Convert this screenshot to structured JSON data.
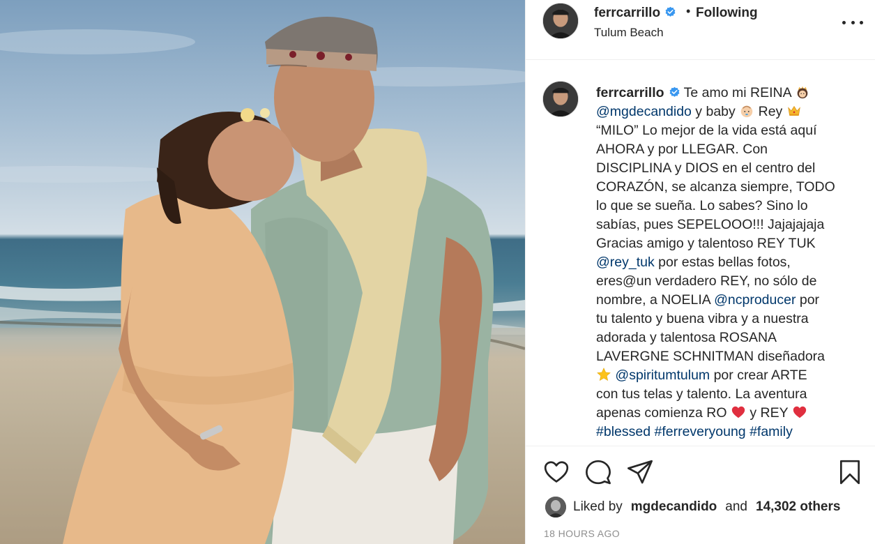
{
  "post": {
    "image_alt": "Couple on beach photo",
    "header": {
      "username": "ferrcarrillo",
      "separator": "•",
      "follow_status": "Following",
      "location": "Tulum Beach",
      "more_icon": "more-options-icon"
    },
    "caption": {
      "username": "ferrcarrillo",
      "lines": [
        {
          "parts": [
            {
              "t": "Te amo mi REINA "
            },
            {
              "emoji": "woman-with-crown"
            }
          ]
        },
        {
          "parts": [
            {
              "t": "@mgdecandido",
              "tag": true
            },
            {
              "t": " y baby "
            },
            {
              "emoji": "baby"
            },
            {
              "t": " Rey "
            },
            {
              "emoji": "crown"
            }
          ]
        },
        {
          "parts": [
            {
              "t": "“MILO” Lo mejor de la vida está aquí"
            }
          ]
        },
        {
          "parts": [
            {
              "t": "AHORA y por LLEGAR. Con"
            }
          ]
        },
        {
          "parts": [
            {
              "t": "DISCIPLINA y DIOS en el centro del"
            }
          ]
        },
        {
          "parts": [
            {
              "t": "CORAZÓN, se alcanza siempre, TODO"
            }
          ]
        },
        {
          "parts": [
            {
              "t": "lo que se sueña. Lo sabes? Sino lo"
            }
          ]
        },
        {
          "parts": [
            {
              "t": "sabías, pues SEPELOOO!!! Jajajajaja"
            }
          ]
        },
        {
          "parts": [
            {
              "t": "Gracias amigo y talentoso REY TUK"
            }
          ]
        },
        {
          "parts": [
            {
              "t": "@rey_tuk",
              "tag": true
            },
            {
              "t": " por estas bellas fotos,"
            }
          ]
        },
        {
          "parts": [
            {
              "t": "eres@un verdadero REY, no sólo de"
            }
          ]
        },
        {
          "parts": [
            {
              "t": "nombre, a NOELIA "
            },
            {
              "t": "@ncproducer",
              "tag": true
            },
            {
              "t": " por"
            }
          ]
        },
        {
          "parts": [
            {
              "t": "tu talento y buena vibra y a nuestra"
            }
          ]
        },
        {
          "parts": [
            {
              "t": "adorada y talentosa ROSANA"
            }
          ]
        },
        {
          "parts": [
            {
              "t": "LAVERGNE SCHNITMAN diseñadora"
            }
          ]
        },
        {
          "parts": [
            {
              "emoji": "star"
            },
            {
              "t": " "
            },
            {
              "t": "@spiritumtulum",
              "tag": true
            },
            {
              "t": " por crear ARTE"
            }
          ]
        },
        {
          "parts": [
            {
              "t": "con tus telas y talento. La aventura"
            }
          ]
        },
        {
          "parts": [
            {
              "t": "apenas comienza RO "
            },
            {
              "emoji": "red-heart"
            },
            {
              "t": " y REY "
            },
            {
              "emoji": "red-heart"
            }
          ]
        },
        {
          "parts": [
            {
              "t": "#blessed",
              "tag": true
            },
            {
              "t": " "
            },
            {
              "t": "#ferreveryoung",
              "tag": true
            },
            {
              "t": " "
            },
            {
              "t": "#family",
              "tag": true
            }
          ]
        }
      ]
    },
    "actions": {
      "like_icon": "heart-icon",
      "comment_icon": "comment-icon",
      "share_icon": "share-icon",
      "save_icon": "bookmark-icon"
    },
    "likes": {
      "prefix": "Liked by",
      "user": "mgdecandido",
      "middle": "and",
      "count": "14,302 others"
    },
    "timestamp": "18 HOURS AGO"
  },
  "colors": {
    "text": "#262626",
    "link": "#00376b",
    "muted": "#8e8e8e",
    "verified": "#3897f0",
    "heart": "#ed4956"
  }
}
